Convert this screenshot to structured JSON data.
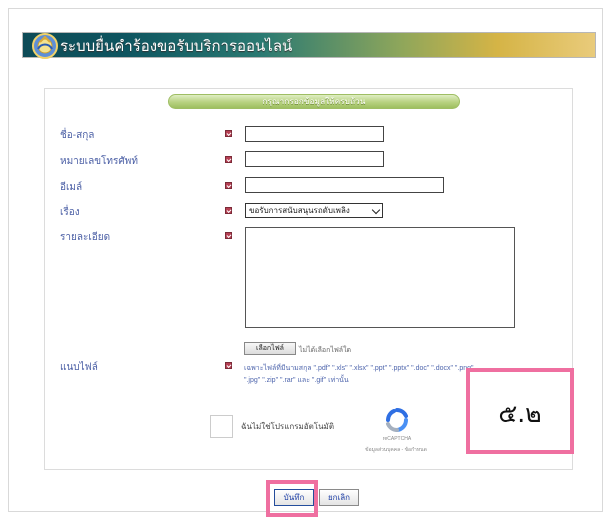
{
  "header": {
    "title": "ระบบยื่นคำร้องขอรับบริการออนไลน์",
    "icon": "emblem-icon"
  },
  "form": {
    "banner_text": "กรุณากรอกข้อมูลให้ครบถ้วน",
    "fields": [
      {
        "label": "ชื่อ-สกุล"
      },
      {
        "label": "หมายเลขโทรศัพท์"
      },
      {
        "label": "อีเมล์"
      },
      {
        "label": "เรื่อง",
        "selected_value": "ขอรับการสนับสนุนรถดับเพลิง"
      },
      {
        "label": "รายละเอียด"
      },
      {
        "label": "แนบไฟล์"
      }
    ],
    "attachment": {
      "button_label": "เลือกไฟล์",
      "status_text": "ไม่ได้เลือกไฟล์ใด",
      "hint_line1": "เฉพาะไฟล์ที่มีนามสกุล \".pdf\" \".xls\" \".xlsx\" \".ppt\" \".pptx\" \".doc\" \".docx\" \".png\"",
      "hint_line2": "\".jpg\" \".zip\" \".rar\" และ \".gif\" เท่านั้น"
    },
    "captcha": {
      "label": "ฉันไม่ใช่โปรแกรมอัตโนมัติ",
      "brand": "reCAPTCHA",
      "links": "ข้อมูลส่วนบุคคล - ข้อกำหนด"
    },
    "annotation": "๕.๒",
    "buttons": {
      "save": "บันทึก",
      "cancel": "ยกเลิก"
    }
  },
  "colors": {
    "header_start": "#0d4b57",
    "header_end": "#e9cb7b",
    "label_blue": "#4b5fa5",
    "required_red": "#b63f53",
    "annotation_pink": "#ef6fa0"
  }
}
